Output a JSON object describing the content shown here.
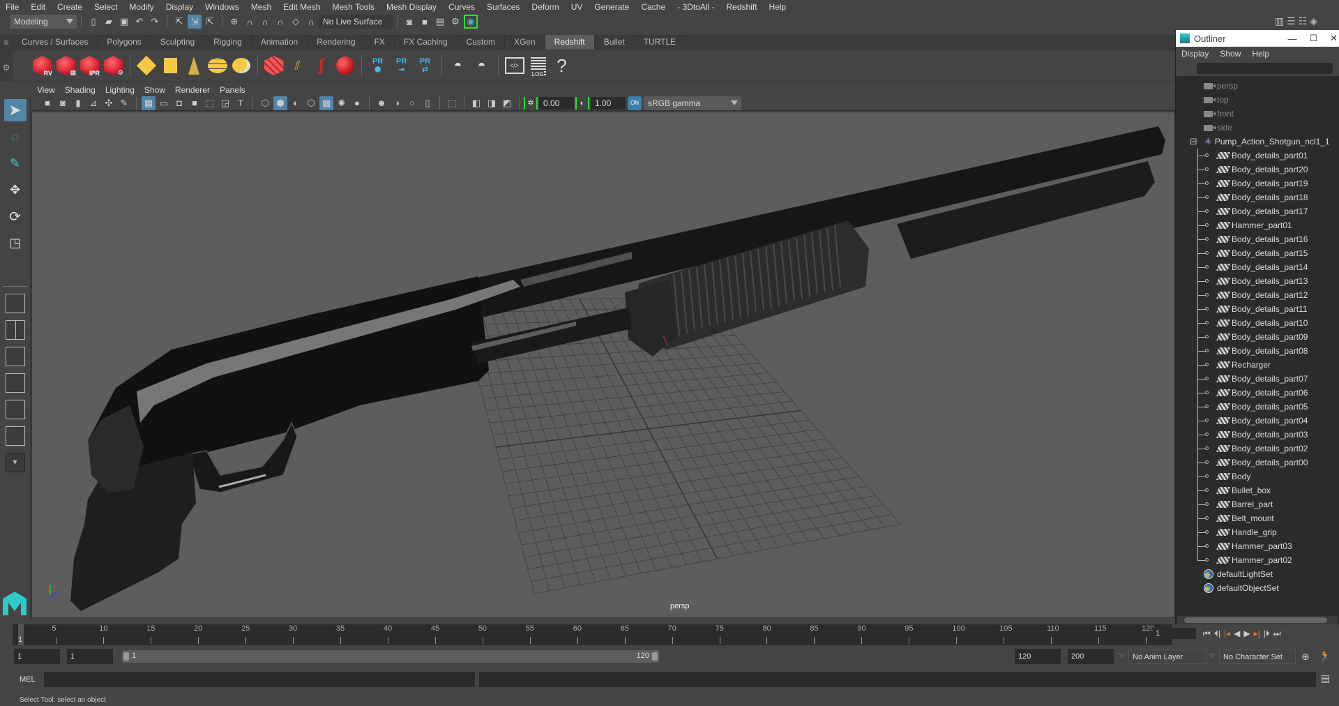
{
  "menubar": [
    "File",
    "Edit",
    "Create",
    "Select",
    "Modify",
    "Display",
    "Windows",
    "Mesh",
    "Edit Mesh",
    "Mesh Tools",
    "Mesh Display",
    "Curves",
    "Surfaces",
    "Deform",
    "UV",
    "Generate",
    "Cache",
    "- 3DtoAll -",
    "Redshift",
    "Help"
  ],
  "statusline": {
    "workspace": "Modeling",
    "live_surface": "No Live Surface"
  },
  "shelf": {
    "tabs": [
      "Curves / Surfaces",
      "Polygons",
      "Sculpting",
      "Rigging",
      "Animation",
      "Rendering",
      "FX",
      "FX Caching",
      "Custom",
      "XGen",
      "Redshift",
      "Bullet",
      "TURTLE"
    ],
    "active_tab": "Redshift",
    "redshift_labels": [
      "RV",
      "",
      "IPR",
      ""
    ],
    "pr_labels": [
      "PR",
      "PR",
      "PR"
    ],
    "log_label": ".LOG",
    "help_label": "?"
  },
  "viewport": {
    "menu": [
      "View",
      "Shading",
      "Lighting",
      "Show",
      "Renderer",
      "Panels"
    ],
    "exposure": "0.00",
    "gamma": "1.00",
    "color_space": "sRGB gamma",
    "camera_label": "persp",
    "colors": {
      "background": "#5d5d5d",
      "gun_body": "#151515",
      "grid": "#3f3f3f",
      "active_tool": "#5285a6"
    }
  },
  "outliner": {
    "title": "Outliner",
    "menu": [
      "Display",
      "Show",
      "Help"
    ],
    "cameras": [
      "persp",
      "top",
      "front",
      "side"
    ],
    "group": "Pump_Action_Shotgun_ncl1_1",
    "children": [
      "Body_details_part01",
      "Body_details_part20",
      "Body_details_part19",
      "Body_details_part18",
      "Body_details_part17",
      "Hammer_part01",
      "Body_details_part16",
      "Body_details_part15",
      "Body_details_part14",
      "Body_details_part13",
      "Body_details_part12",
      "Body_details_part11",
      "Body_details_part10",
      "Body_details_part09",
      "Body_details_part08",
      "Recharger",
      "Body_details_part07",
      "Body_details_part06",
      "Body_details_part05",
      "Body_details_part04",
      "Body_details_part03",
      "Body_details_part02",
      "Body_details_part00",
      "Body",
      "Bullet_box",
      "Barrel_part",
      "Belt_mount",
      "Handle_grip",
      "Hammer_part03",
      "Hammer_part02"
    ],
    "sets": [
      "defaultLightSet",
      "defaultObjectSet"
    ]
  },
  "timeline": {
    "ticks": [
      "5",
      "10",
      "15",
      "20",
      "25",
      "30",
      "35",
      "40",
      "45",
      "50",
      "55",
      "60",
      "65",
      "70",
      "75",
      "80",
      "85",
      "90",
      "95",
      "100",
      "105",
      "110",
      "115",
      "120"
    ],
    "current_frame": "1",
    "current_frame_field": "1"
  },
  "range": {
    "start": "1",
    "playback_start": "1",
    "slider_start": "1",
    "slider_end": "120",
    "playback_end": "120",
    "end": "200",
    "anim_layer": "No Anim Layer",
    "character_set": "No Character Set"
  },
  "mel": {
    "label": "MEL"
  },
  "helpline": "Select Tool: select an object"
}
